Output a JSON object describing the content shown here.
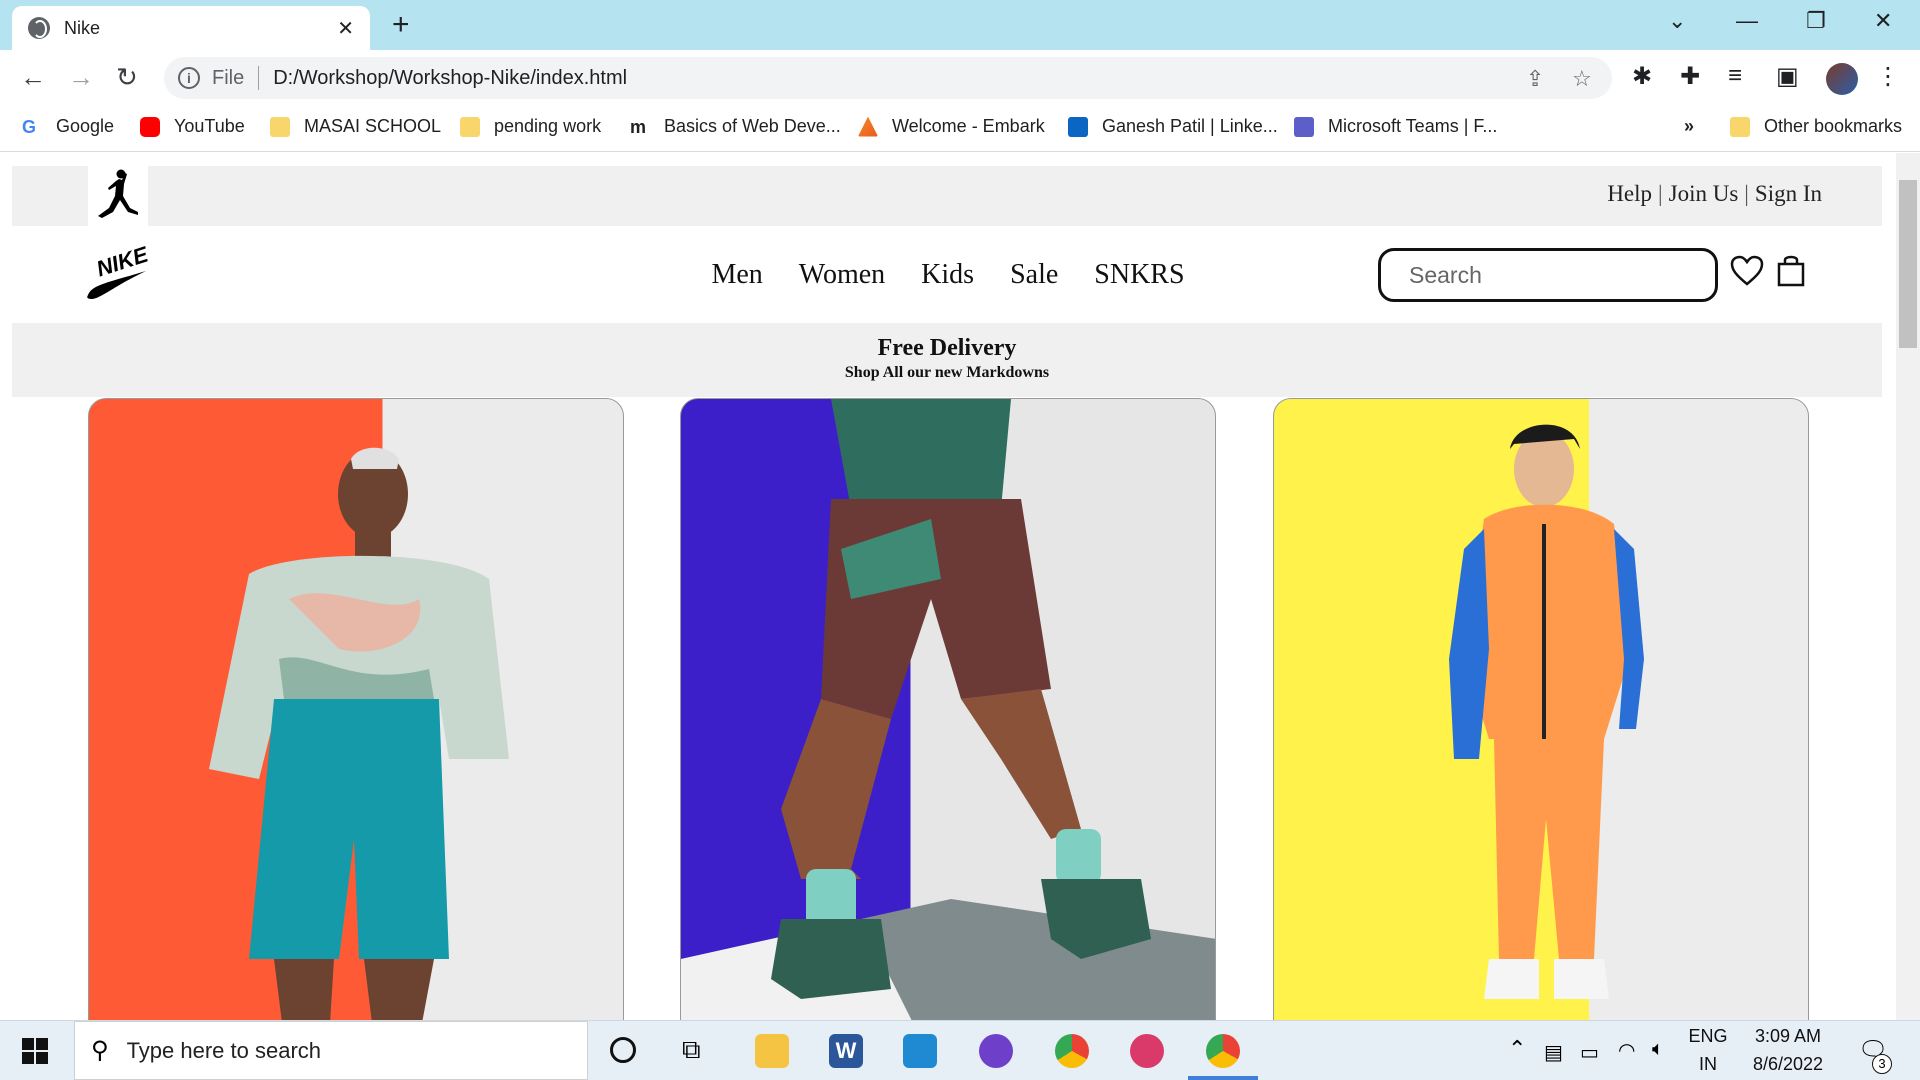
{
  "browser": {
    "tab_title": "Nike",
    "url_scheme": "File",
    "url": "D:/Workshop/Workshop-Nike/index.html",
    "bookmarks": [
      {
        "label": "Google",
        "icon": "google-icon",
        "color": "#4285f4"
      },
      {
        "label": "YouTube",
        "icon": "youtube-icon",
        "color": "#ff0000"
      },
      {
        "label": "MASAI SCHOOL",
        "icon": "folder-icon",
        "color": "#f9d66b"
      },
      {
        "label": "pending work",
        "icon": "folder-icon",
        "color": "#f9d66b"
      },
      {
        "label": "Basics of Web Deve...",
        "icon": "masai-m-icon",
        "color": "#111111"
      },
      {
        "label": "Welcome - Embark",
        "icon": "embark-icon",
        "color": "#f28c28"
      },
      {
        "label": "Ganesh Patil | Linke...",
        "icon": "linkedin-icon",
        "color": "#0a66c2"
      },
      {
        "label": "Microsoft Teams | F...",
        "icon": "teams-icon",
        "color": "#5b5fc7"
      }
    ],
    "overflow_label": "»",
    "other_bookmarks": "Other bookmarks"
  },
  "site": {
    "top_links": [
      "Help",
      "Join Us",
      "Sign In"
    ],
    "nav": [
      "Men",
      "Women",
      "Kids",
      "Sale",
      "SNKRS"
    ],
    "search_placeholder": "Search",
    "banner_title": "Free Delivery",
    "banner_subtitle": "Shop All our new Markdowns",
    "cards": [
      {
        "name": "card-tie-dye-outfit",
        "colors": [
          "#ff5a36",
          "#ebebeb"
        ]
      },
      {
        "name": "card-training-shorts",
        "colors": [
          "#3d1fc9",
          "#e6e6e6"
        ]
      },
      {
        "name": "card-tech-fleece",
        "colors": [
          "#fff24a",
          "#ececec"
        ]
      }
    ]
  },
  "taskbar": {
    "search_placeholder": "Type here to search",
    "lang_top": "ENG",
    "lang_bottom": "IN",
    "time": "3:09 AM",
    "date": "8/6/2022",
    "notification_count": "3"
  }
}
